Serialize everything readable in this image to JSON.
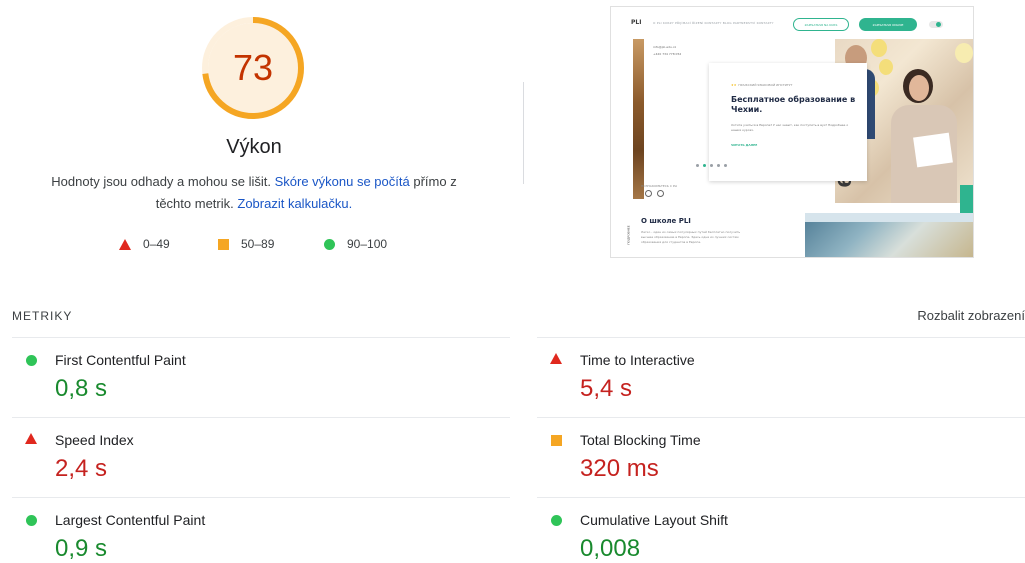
{
  "score": {
    "value": "73",
    "fraction": 0.73,
    "title": "Výkon",
    "description_prefix": "Hodnoty jsou odhady a mohou se lišit.",
    "link_score": "Skóre výkonu se počítá",
    "description_mid": "přímo z těchto metrik.",
    "link_calc": "Zobrazit kalkulačku.",
    "colors": {
      "ring": "#f5a623",
      "track": "#fdf0dd",
      "text": "#c33300"
    }
  },
  "legend": {
    "poor": "0–49",
    "average": "50–89",
    "good": "90–100"
  },
  "thumbnail": {
    "logo": "PLI",
    "menu": "O PLI  KURZY  PŘIJÍMACÍ  ŘÍZENÍ  KONTAKTY  BLOG  PARTNERSTVÍ  KONTAKTY",
    "btn_outline": "ZAPISATЬSЯ  NA  KURS",
    "btn_filled": "ZAPISATЬSЯ  ONLINE",
    "contact_1": "info@pli-edu.cz",
    "contact_2": "+420 734 778 052",
    "eyebrow": "ПРАЖСКИЙ ЯЗЫКОВОЙ ИНСТИТУТ",
    "card_title": "Бесплатное образование в Чехии.",
    "card_text": "Хотите учиться в Европе? У нас знают, как поступить в вуз? Подробнее о наших курсах.",
    "card_link": "ЧИТАТЬ ДАЛЕЕ",
    "small_text": "ПОЗНАКОМЬТЕСЬ С PLI",
    "digit": "9",
    "about_title": "О школе PLI",
    "about_text": "Легко - один из самых популярных путей бесплатно получить высшее образование в Европе. Здесь одна из лучших систем образования для студентов в Европе.",
    "side_label": "ПОДРОБНЕЕ"
  },
  "metrics": {
    "heading": "METRIKY",
    "expand_label": "Rozbalit zobrazení",
    "items": [
      {
        "label": "First Contentful Paint",
        "value": "0,8 s",
        "rating": "good"
      },
      {
        "label": "Time to Interactive",
        "value": "5,4 s",
        "rating": "poor"
      },
      {
        "label": "Speed Index",
        "value": "2,4 s",
        "rating": "poor"
      },
      {
        "label": "Total Blocking Time",
        "value": "320 ms",
        "rating": "average"
      },
      {
        "label": "Largest Contentful Paint",
        "value": "0,9 s",
        "rating": "good"
      },
      {
        "label": "Cumulative Layout Shift",
        "value": "0,008",
        "rating": "good"
      }
    ]
  }
}
